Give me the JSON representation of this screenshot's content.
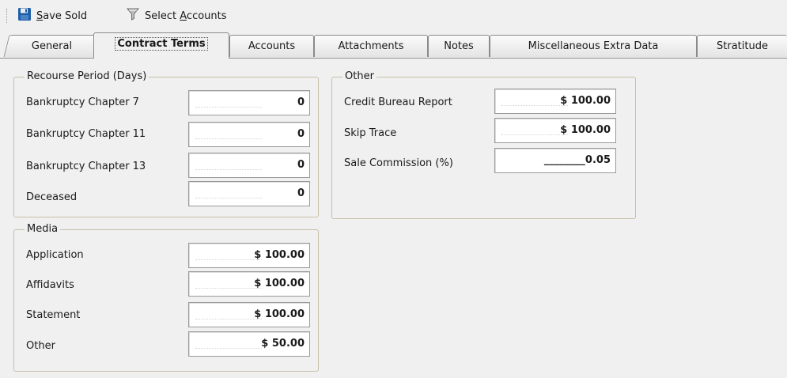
{
  "toolbar": {
    "save_label_pre": "",
    "save_label_mnemonic": "S",
    "save_label_post": "ave Sold",
    "select_label_pre": "Select ",
    "select_label_mnemonic": "A",
    "select_label_post": "ccounts"
  },
  "tabs": [
    {
      "label": "General"
    },
    {
      "label": "Contract Terms"
    },
    {
      "label": "Accounts"
    },
    {
      "label": "Attachments"
    },
    {
      "label": "Notes"
    },
    {
      "label": "Miscellaneous Extra Data"
    },
    {
      "label": "Stratitude"
    }
  ],
  "recourse": {
    "title": "Recourse Period (Days)",
    "fields": [
      {
        "label": "Bankruptcy Chapter 7",
        "value": "0"
      },
      {
        "label": "Bankruptcy Chapter 11",
        "value": "0"
      },
      {
        "label": "Bankruptcy Chapter 13",
        "value": "0"
      },
      {
        "label": "Deceased",
        "value": "0"
      }
    ]
  },
  "media": {
    "title": "Media",
    "fields": [
      {
        "label": "Application",
        "value": "$ 100.00"
      },
      {
        "label": "Affidavits",
        "value": "$ 100.00"
      },
      {
        "label": "Statement",
        "value": "$ 100.00"
      },
      {
        "label": "Other",
        "value": "$ 50.00"
      }
    ]
  },
  "other": {
    "title": "Other",
    "fields": [
      {
        "label": "Credit Bureau Report",
        "value": "$ 100.00"
      },
      {
        "label": "Skip Trace",
        "value": "$ 100.00"
      },
      {
        "label": "Sale Commission (%)",
        "value": "________0.05"
      }
    ]
  },
  "icons": {
    "save": "floppy-disk-icon",
    "filter": "funnel-icon"
  },
  "colors": {
    "save_icon": "#1f5fa8",
    "group_border": "#c7bfa8",
    "background": "#f0f0f0"
  }
}
